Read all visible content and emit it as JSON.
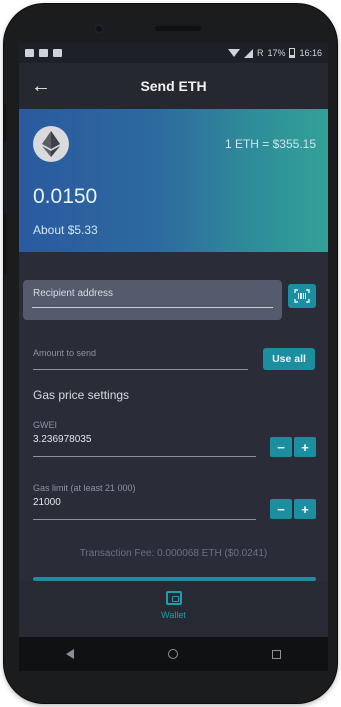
{
  "status_bar": {
    "battery": "17%",
    "time": "16:16",
    "extra": "R"
  },
  "app_bar": {
    "title": "Send ETH"
  },
  "hero": {
    "rate": "1 ETH = $355.15",
    "amount": "0.0150",
    "about": "About $5.33"
  },
  "form": {
    "recipient_label": "Recipient address",
    "recipient_value": "",
    "amount_placeholder": "Amount to send",
    "use_all_label": "Use all",
    "gas_title": "Gas price settings",
    "gwei_label": "GWEI",
    "gwei_value": "3.236978035",
    "gas_limit_label": "Gas limit (at least 21 000)",
    "gas_limit_value": "21000",
    "stepper_minus": "−",
    "stepper_plus": "+"
  },
  "fee": "Transaction Fee: 0.000068 ETH ($0.0241)",
  "bottom_nav": {
    "wallet_label": "Wallet"
  },
  "colors": {
    "accent": "#1b8ea0",
    "background": "#2a2d37",
    "hero_start": "#2a5aa0",
    "hero_end": "#33a197"
  }
}
